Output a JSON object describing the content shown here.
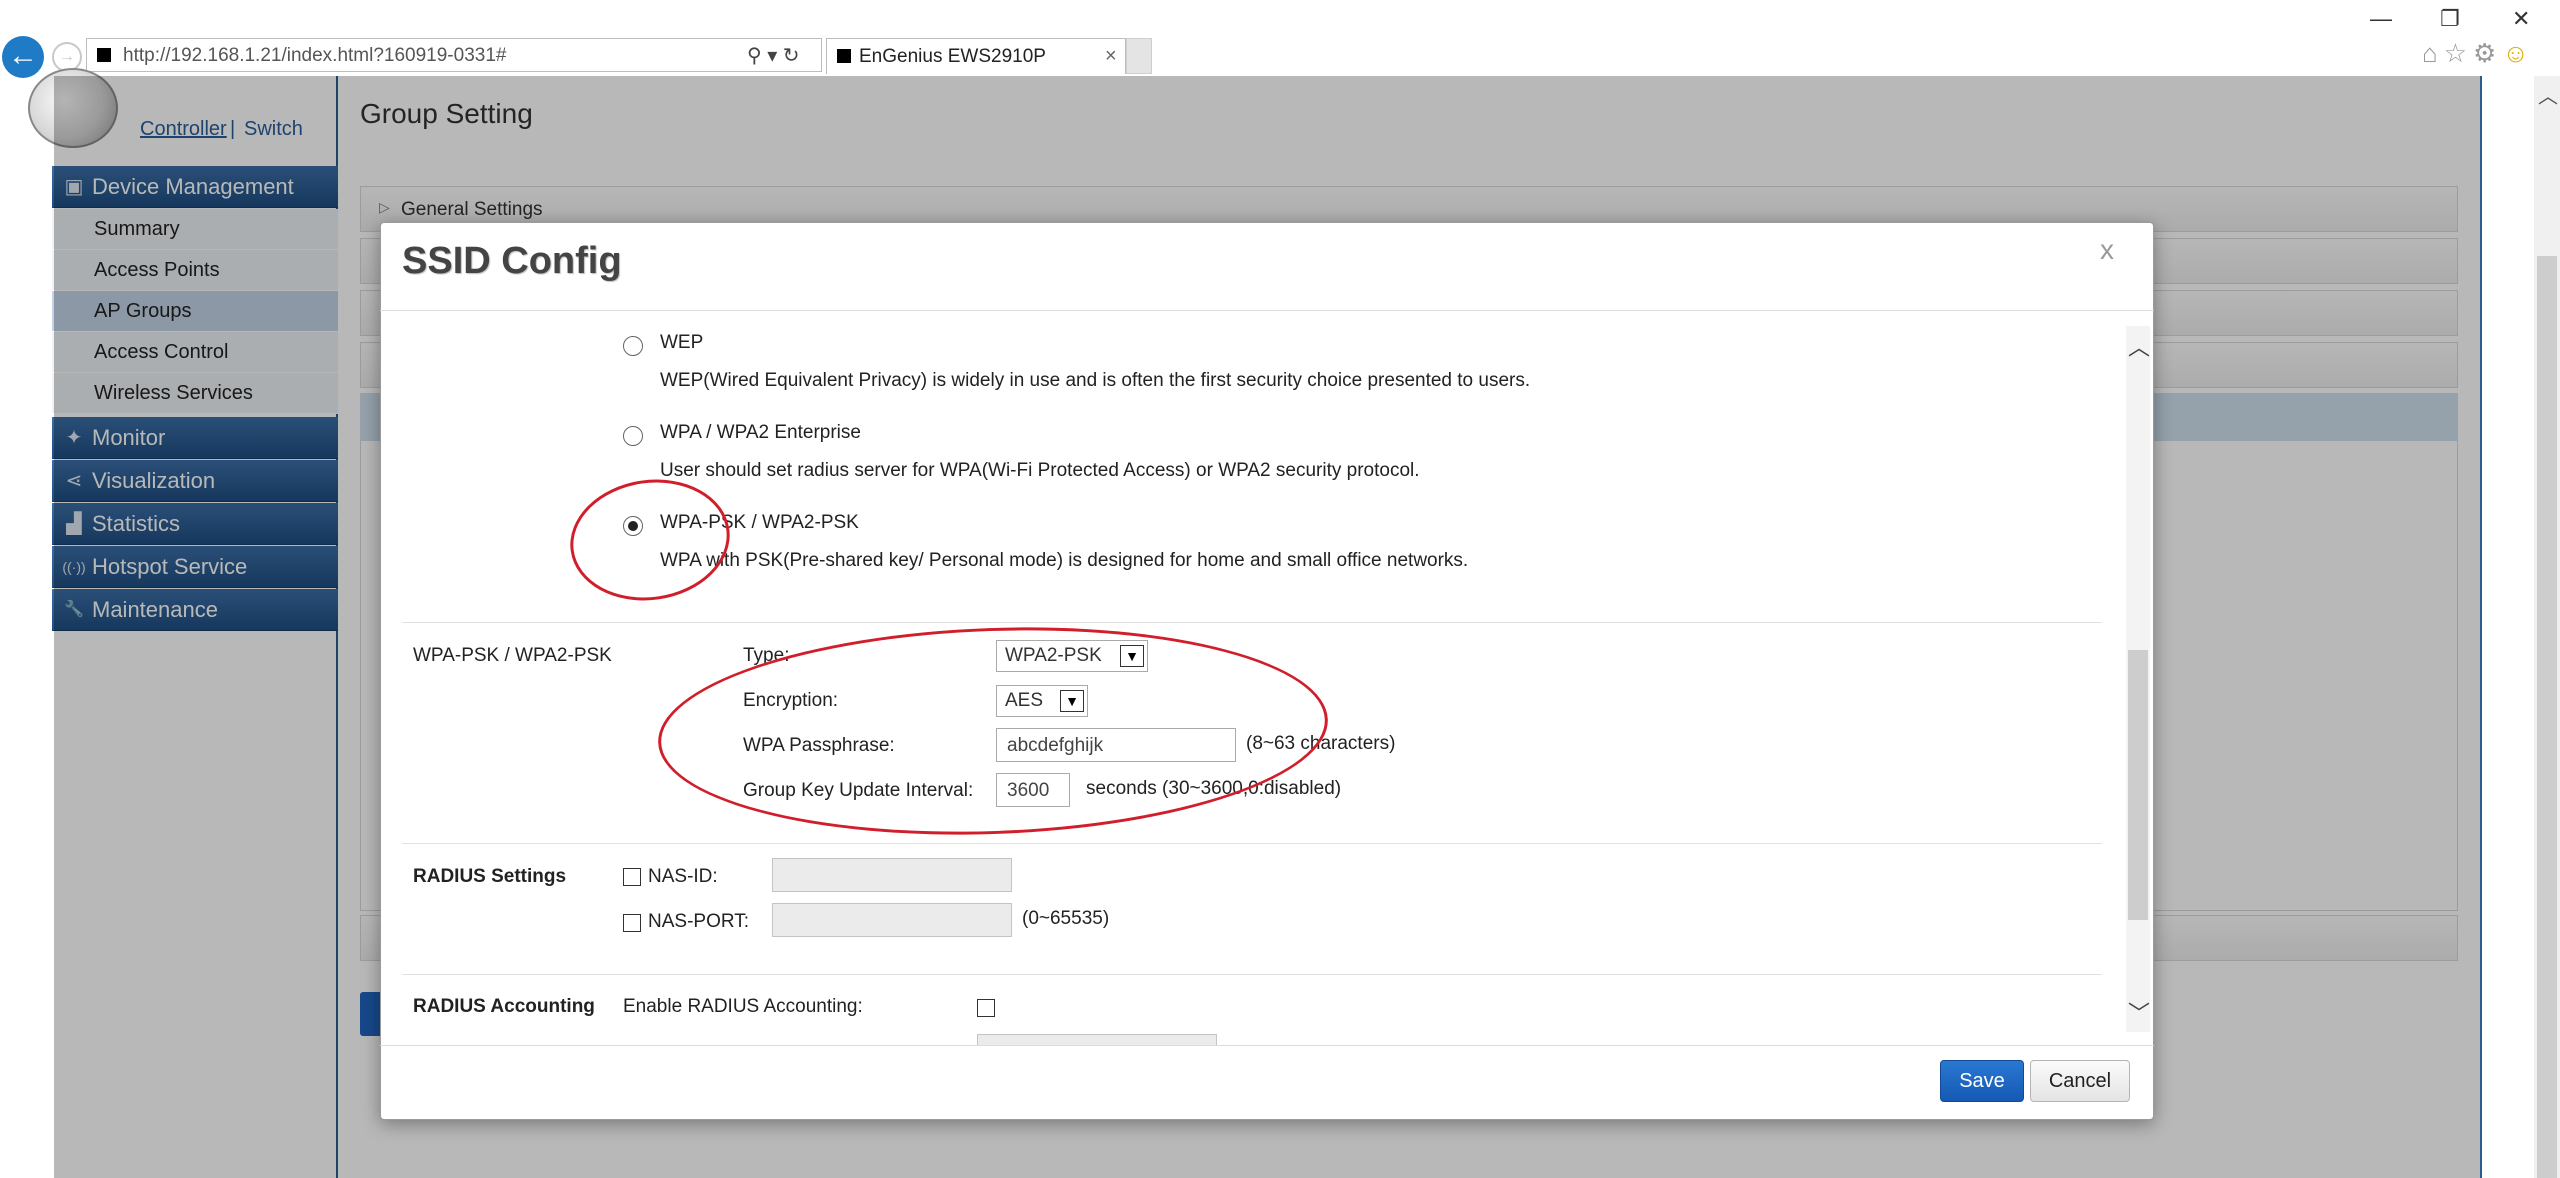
{
  "browser": {
    "url": "http://192.168.1.21/index.html?160919-0331#",
    "tab_title": "EnGenius EWS2910P",
    "tab_close": "×",
    "address_tools": "⚲ ▾ ↻",
    "window_controls": {
      "minimize": "—",
      "restore": "❐",
      "close": "✕"
    },
    "toolbar_icons": {
      "home": "⌂",
      "favorites": "☆",
      "settings": "⚙",
      "feedback": "☺"
    },
    "back": "←",
    "forward": "→"
  },
  "header": {
    "controller_link": "Controller",
    "separator": "|",
    "switch_link": "Switch"
  },
  "sidebar": {
    "device_management": "Device Management",
    "items": [
      {
        "label": "Summary",
        "active": false
      },
      {
        "label": "Access Points",
        "active": false
      },
      {
        "label": "AP Groups",
        "active": true
      },
      {
        "label": "Access Control",
        "active": false
      },
      {
        "label": "Wireless Services",
        "active": false
      }
    ],
    "sections": [
      {
        "label": "Monitor",
        "icon": "monitor-icon",
        "glyph": "✦"
      },
      {
        "label": "Visualization",
        "icon": "share-icon",
        "glyph": "⋖"
      },
      {
        "label": "Statistics",
        "icon": "chart-icon",
        "glyph": "▟"
      },
      {
        "label": "Hotspot Service",
        "icon": "wifi-icon",
        "glyph": "((·))"
      },
      {
        "label": "Maintenance",
        "icon": "wrench-icon",
        "glyph": "🔧"
      }
    ],
    "device_management_glyph": "▣"
  },
  "main": {
    "page_title": "Group Setting",
    "accordion_first": "General Settings",
    "accordion_tri": "▷"
  },
  "modal": {
    "title": "SSID Config",
    "close": "x",
    "security_options": [
      {
        "label": "WEP",
        "description": "WEP(Wired Equivalent Privacy) is widely in use and is often the first security choice presented to users.",
        "selected": false
      },
      {
        "label": "WPA / WPA2 Enterprise",
        "description": "User should set radius server for WPA(Wi-Fi Protected Access) or WPA2 security protocol.",
        "selected": false
      },
      {
        "label": "WPA-PSK / WPA2-PSK",
        "description": "WPA with PSK(Pre-shared key/ Personal mode) is designed for home and small office networks.",
        "selected": true
      }
    ],
    "psk_section": {
      "heading": "WPA-PSK / WPA2-PSK",
      "type_label": "Type:",
      "type_value": "WPA2-PSK",
      "encryption_label": "Encryption:",
      "encryption_value": "AES",
      "passphrase_label": "WPA Passphrase:",
      "passphrase_value": "abcdefghijk",
      "passphrase_hint": "(8~63 characters)",
      "gkui_label": "Group Key Update Interval:",
      "gkui_value": "3600",
      "gkui_hint": "seconds (30~3600,0:disabled)"
    },
    "radius_settings": {
      "heading": "RADIUS Settings",
      "nas_id_label": "NAS-ID:",
      "nas_port_label": "NAS-PORT:",
      "nas_port_hint": "(0~65535)"
    },
    "radius_accounting": {
      "heading": "RADIUS Accounting",
      "enable_label": "Enable RADIUS Accounting:"
    },
    "scroll_up": "︿",
    "scroll_down": "﹀",
    "dropdown_arrow": "▼",
    "save_label": "Save",
    "cancel_label": "Cancel"
  },
  "colors": {
    "nav_header": "#2b5d8f",
    "nav_active": "#c3d3e6",
    "primary_button": "#1a63c0",
    "annotation": "#d11e2b",
    "link": "#2a5e9a"
  }
}
